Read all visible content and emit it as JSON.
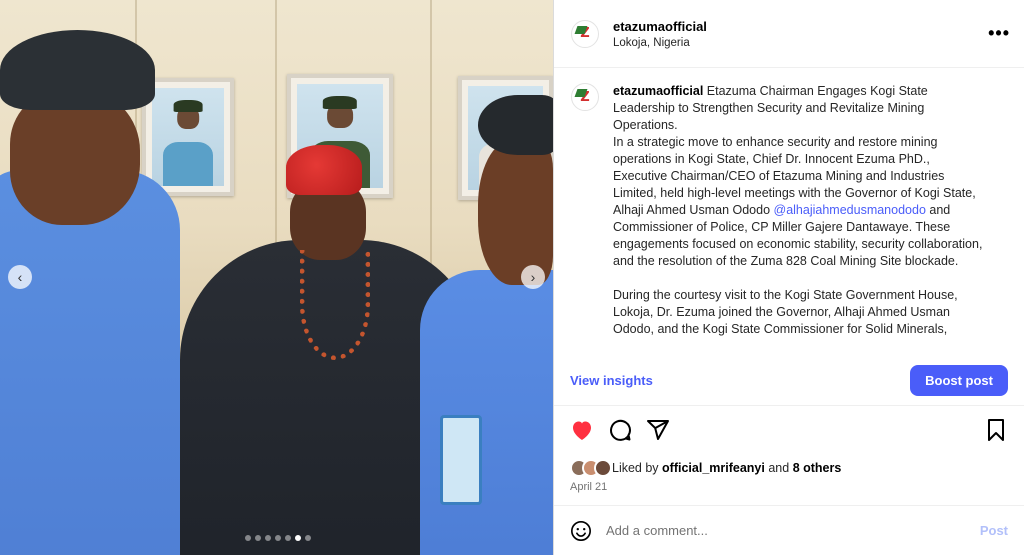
{
  "post": {
    "username": "etazumaofficial",
    "location": "Lokoja, Nigeria",
    "more_label": "•••",
    "caption_intro": "Etazuma Chairman Engages Kogi State Leadership to Strengthen Security and Revitalize Mining Operations.",
    "caption_p1a": "In a strategic move to enhance security and restore mining operations in Kogi State, Chief Dr. Innocent Ezuma PhD., Executive Chairman/CEO of Etazuma Mining and Industries Limited, held high-level meetings with the Governor of Kogi State, Alhaji Ahmed Usman Ododo ",
    "caption_mention": "@alhajiahmedusmanododo",
    "caption_p1b": " and Commissioner of Police, CP Miller Gajere Dantawaye. These engagements focused on economic stability, security collaboration, and the resolution of the Zuma 828 Coal Mining Site blockade.",
    "caption_p2": "During the courtesy visit to the Kogi State Government House, Lokoja, Dr. Ezuma joined the Governor, Alhaji Ahmed Usman Ododo, and the Kogi State Commissioner for Solid Minerals,"
  },
  "insights_label": "View insights",
  "boost_label": "Boost post",
  "likes": {
    "prefix": "Liked by ",
    "user": "official_mrifeanyi",
    "middle": " and ",
    "others": "8 others"
  },
  "date": "April 21",
  "comment": {
    "placeholder": "Add a comment...",
    "post_label": "Post"
  },
  "carousel": {
    "total": 7,
    "active": 5
  },
  "colors": {
    "accent": "#4a5df9",
    "like_red": "#ff3040",
    "post_disabled": "#b2c0fa"
  },
  "icons": [
    "heart-icon",
    "comment-icon",
    "share-icon",
    "bookmark-icon",
    "emoji-icon",
    "chevron-left-icon",
    "chevron-right-icon",
    "more-icon"
  ]
}
